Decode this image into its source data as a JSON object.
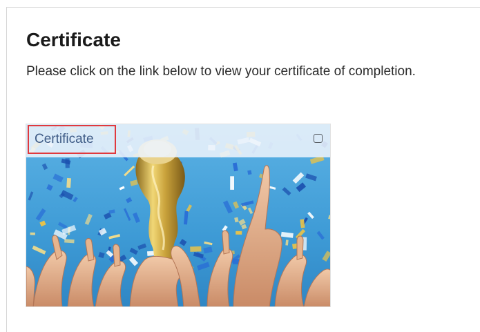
{
  "page": {
    "title": "Certificate",
    "instructions": "Please click on the link below to view your certificate of completion."
  },
  "card": {
    "link_label": "Certificate",
    "image_alt": "Hands raised holding a golden trophy amid confetti",
    "checkbox_checked": false
  },
  "colors": {
    "link_text": "#3e5b86",
    "highlight_border": "#e0393e",
    "confetti_blue": "#2a6fd6",
    "confetti_gold": "#e7c24a",
    "background_sky": "#4fa6dc"
  }
}
